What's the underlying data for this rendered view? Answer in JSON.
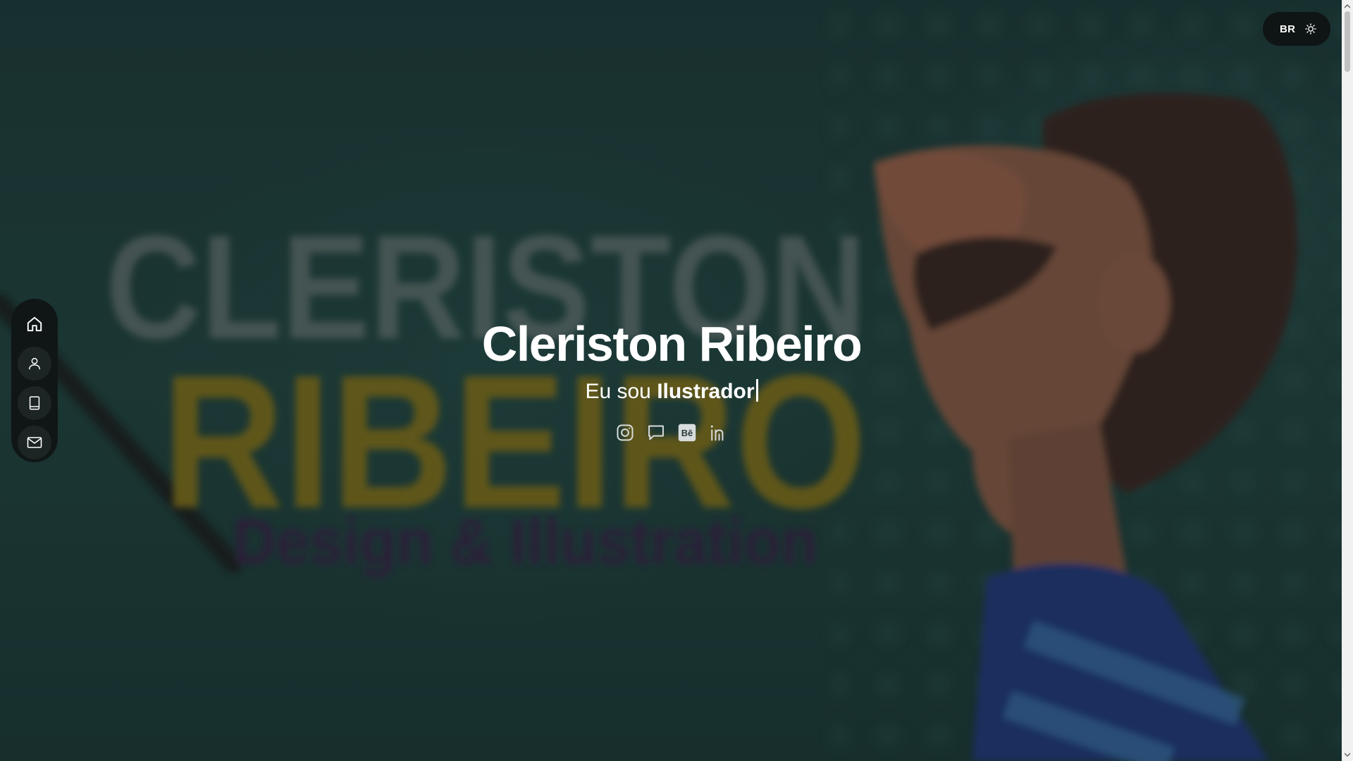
{
  "header": {
    "language_label": "BR",
    "theme_icon": "sun-icon"
  },
  "sidebar": {
    "items": [
      {
        "icon": "home-icon",
        "active": true
      },
      {
        "icon": "user-icon",
        "active": false
      },
      {
        "icon": "book-icon",
        "active": false
      },
      {
        "icon": "mail-icon",
        "active": false
      }
    ]
  },
  "hero": {
    "name": "Cleriston Ribeiro",
    "subtitle_prefix": "Eu sou",
    "subtitle_role": "Ilustrador",
    "background_text": {
      "line1": "CLERISTON",
      "line2": "RIBEIRO",
      "line3": "Design & Illustration"
    }
  },
  "social": [
    {
      "icon": "instagram-icon"
    },
    {
      "icon": "chat-icon"
    },
    {
      "icon": "behance-icon",
      "glyph": "Bē"
    },
    {
      "icon": "linkedin-icon"
    }
  ],
  "colors": {
    "background": "#1f3f3d",
    "panel": "#0f1414",
    "text": "#ffffff",
    "logo_yellow": "#8a7416",
    "logo_purple": "#3a2348"
  }
}
